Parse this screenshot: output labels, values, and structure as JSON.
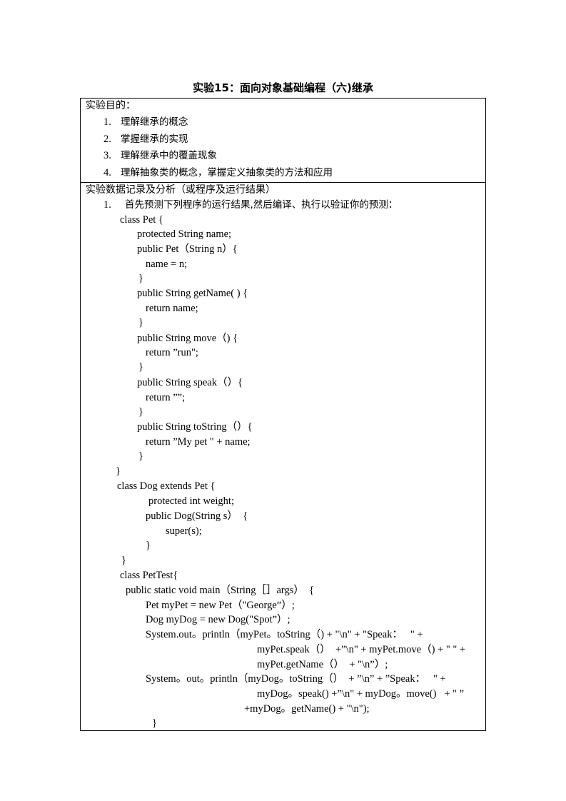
{
  "title": "实验15：面向对象基础编程（六)继承",
  "objectives": {
    "header": "实验目的：",
    "items": [
      {
        "num": "1.",
        "text": "理解继承的概念"
      },
      {
        "num": "2.",
        "text": "掌握继承的实现"
      },
      {
        "num": "3.",
        "text": "理解继承中的覆盖现象"
      },
      {
        "num": "4.",
        "text": "理解抽象类的概念，掌握定义抽象类的方法和应用"
      }
    ]
  },
  "records": {
    "header": "实验数据记录及分析（或程序及运行结果）",
    "task": {
      "num": "1.",
      "text": "首先预测下列程序的运行结果,然后编译、执行以验证你的预测："
    },
    "code_lines": [
      "class Pet {",
      "protected String name;",
      "public Pet（String n）{",
      "name = n;",
      "}",
      "public String getName( ) {",
      "return name;",
      "}",
      "public String move（) {",
      "return ”run\";",
      "}",
      "public String speak（）{",
      "return ””;",
      "}",
      "public String toString（）{",
      "return ”My pet \" + name;",
      "}",
      "}",
      "class Dog extends Pet {",
      "protected int weight;",
      "public Dog(String s）  {",
      "super(s);",
      "}",
      "}",
      "class PetTest{",
      "public static void main（String［］args）  {",
      "Pet myPet = new Pet（\"George”）;",
      "Dog myDog = new Dog(\"Spot”）;",
      "System.out。println（myPet。toString（) + \"\\n\" + \"Speak：   \" +",
      "myPet.speak（）  +”\\n\" + myPet.move（) + \" \" +",
      "myPet.getName（）  + \"\\n”）;",
      "System。out。println（myDog。toString（）  + ”\\n” + ”Speak：   \" +",
      "myDog。speak() +”\\n\" + myDog。move()   + \" ”",
      "+myDog。getName() + \"\\n\");",
      "}"
    ]
  }
}
